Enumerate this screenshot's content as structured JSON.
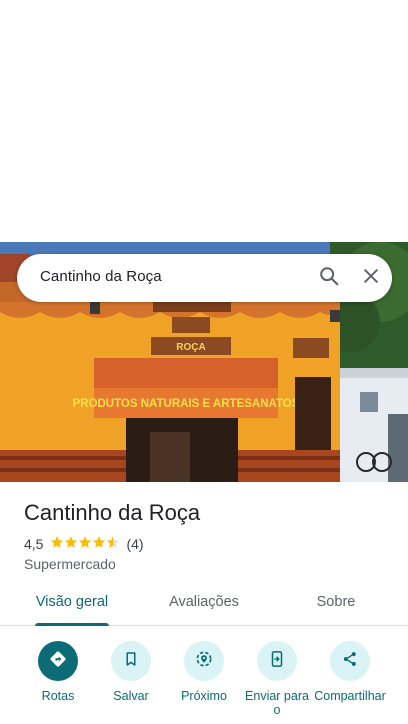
{
  "search": {
    "query": "Cantinho da Roça"
  },
  "place": {
    "name": "Cantinho da Roça",
    "rating": "4,5",
    "rating_stars": 4.5,
    "review_count": "(4)",
    "category": "Supermercado"
  },
  "photo": {
    "sign_main": "PRODUTOS NATURAIS E ARTESANATOS",
    "sign_small": "ROÇA"
  },
  "tabs": [
    {
      "label": "Visão geral",
      "active": true
    },
    {
      "label": "Avaliações",
      "active": false
    },
    {
      "label": "Sobre",
      "active": false
    }
  ],
  "actions": [
    {
      "label": "Rotas",
      "icon": "directions-icon",
      "primary": true
    },
    {
      "label": "Salvar",
      "icon": "bookmark-icon",
      "primary": false
    },
    {
      "label": "Próximo",
      "icon": "nearby-icon",
      "primary": false
    },
    {
      "label": "Enviar para o",
      "icon": "send-to-phone-icon",
      "primary": false
    },
    {
      "label": "Compartilhar",
      "icon": "share-icon",
      "primary": false
    }
  ],
  "colors": {
    "accent": "#0b6b77",
    "accent_light": "#d9f3f7",
    "star": "#fbbc04",
    "text_primary": "#202124",
    "text_secondary": "#5f6368"
  }
}
